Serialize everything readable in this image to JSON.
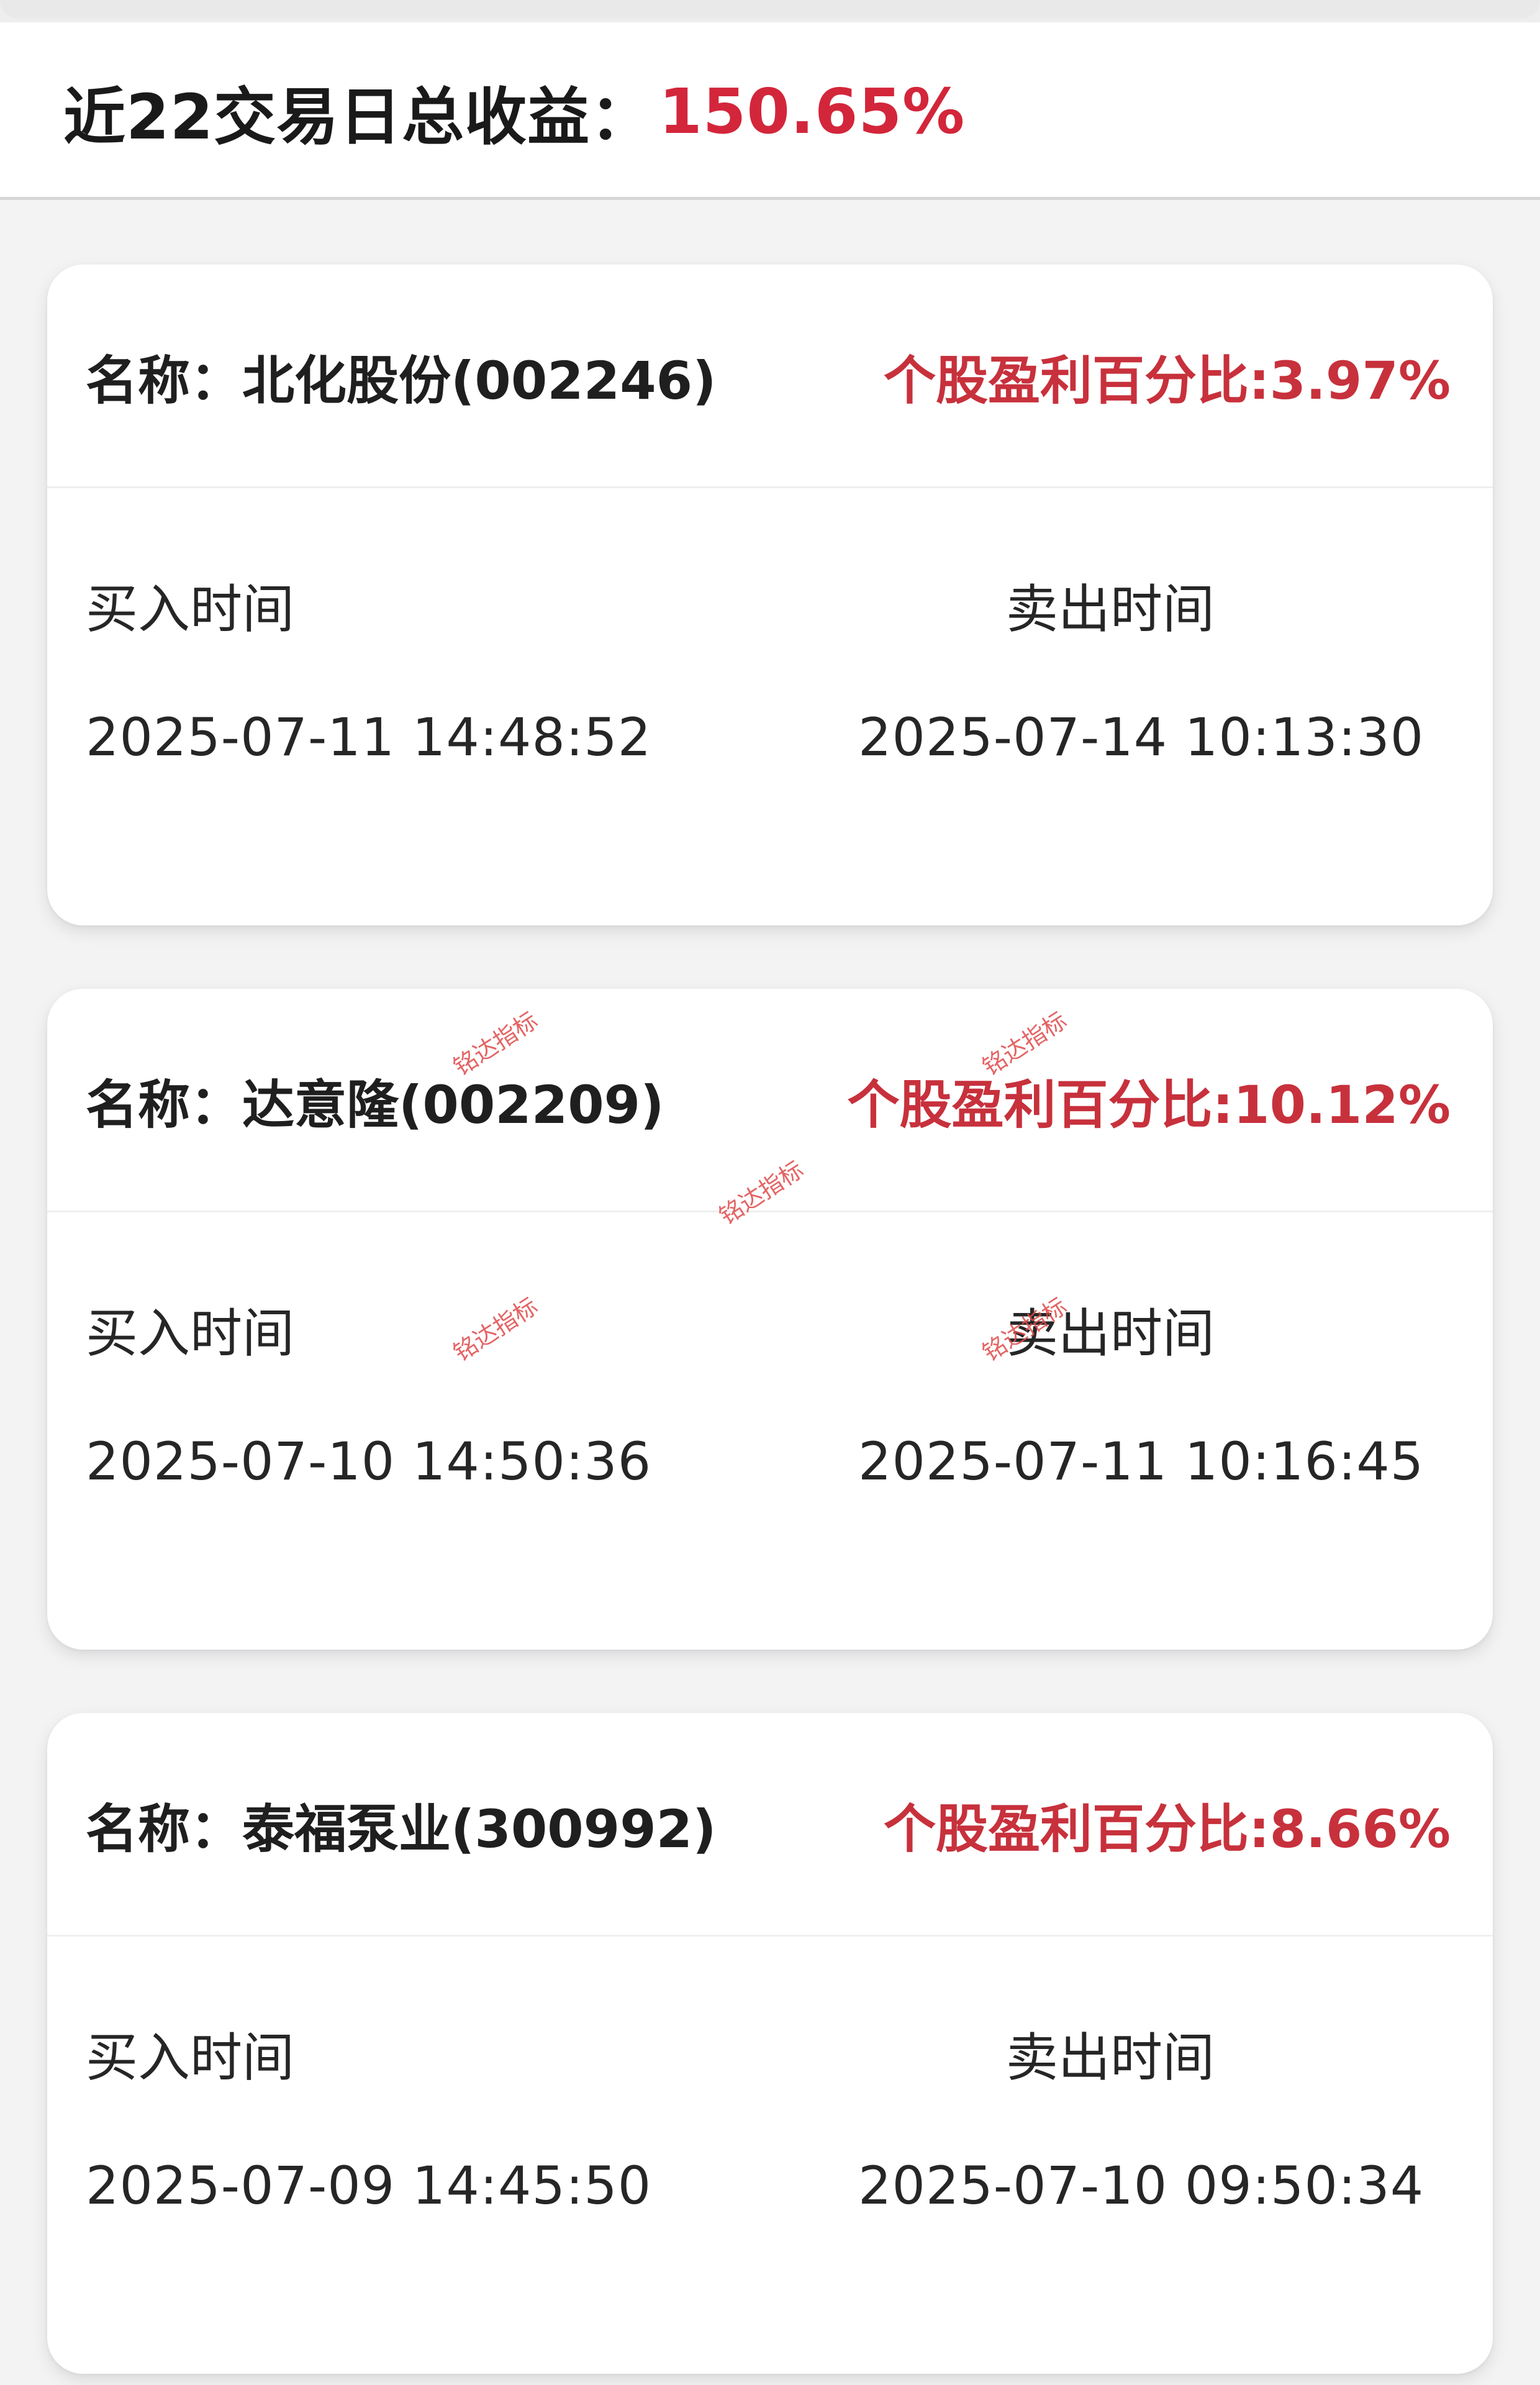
{
  "header": {
    "label": "近22交易日总收益：",
    "value": "150.65%"
  },
  "trades": [
    {
      "name_label": "名称：",
      "stock": "北化股份(002246)",
      "profit": "个股盈利百分比:3.97%",
      "buy_label": "买入时间",
      "sell_label": "卖出时间",
      "buy_time": "2025-07-11 14:48:52",
      "sell_time": "2025-07-14 10:13:30"
    },
    {
      "name_label": "名称：",
      "stock": "达意隆(002209)",
      "profit": "个股盈利百分比:10.12%",
      "buy_label": "买入时间",
      "sell_label": "卖出时间",
      "buy_time": "2025-07-10 14:50:36",
      "sell_time": "2025-07-11 10:16:45"
    },
    {
      "name_label": "名称：",
      "stock": "泰福泵业(300992)",
      "profit": "个股盈利百分比:8.66%",
      "buy_label": "买入时间",
      "sell_label": "卖出时间",
      "buy_time": "2025-07-09 14:45:50",
      "sell_time": "2025-07-10 09:50:34"
    }
  ],
  "watermark": {
    "text": "铭达指标"
  },
  "colors": {
    "profit_red": "#c7313c",
    "header_red": "#d3263a",
    "watermark_red": "#e04a4a",
    "background": "#f3f3f4"
  }
}
